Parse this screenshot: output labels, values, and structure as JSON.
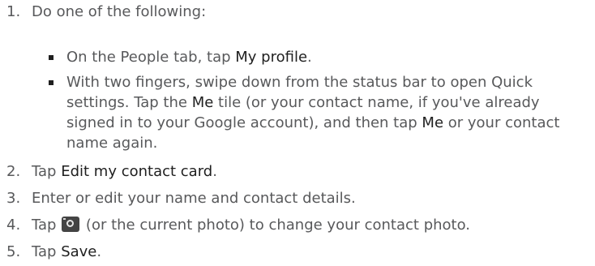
{
  "steps": [
    {
      "number": "1.",
      "text": "Do one of the following:"
    },
    {
      "number": "2.",
      "text_before": "Tap ",
      "ui": "Edit my contact card",
      "text_after": "."
    },
    {
      "number": "3.",
      "text": "Enter or edit your name and contact details."
    },
    {
      "number": "4.",
      "text_before": "Tap ",
      "text_after": " (or the current photo) to change your contact photo.",
      "icon": "camera-icon"
    },
    {
      "number": "5.",
      "text_before": "Tap ",
      "ui": "Save",
      "text_after": "."
    }
  ],
  "bullets": [
    {
      "text_before": "On the People tab, tap ",
      "ui": "My profile",
      "text_after": "."
    },
    {
      "text_before": "With two fingers, swipe down from the status bar to open Quick settings. Tap the ",
      "ui_1": "Me",
      "text_middle": " tile (or your contact name, if you've already signed in to your Google account), and then tap ",
      "ui_2": "Me",
      "text_after": " or your contact name again."
    }
  ],
  "colors": {
    "body_text": "#58595b",
    "ui_text": "#1f1f1f",
    "icon_fill": "#444444"
  }
}
